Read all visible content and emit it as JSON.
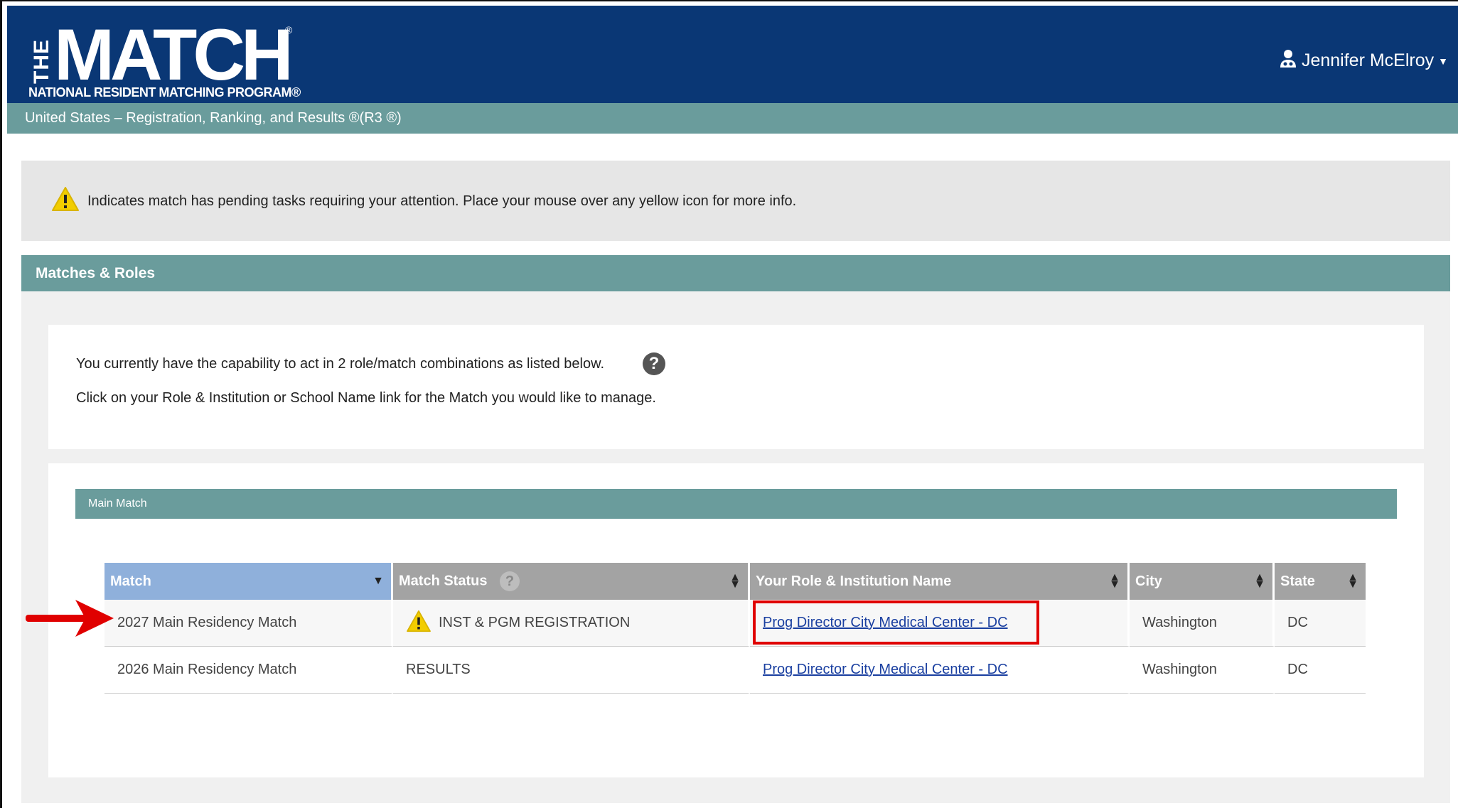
{
  "header": {
    "logo_the": "THE",
    "logo_match": "MATCH",
    "logo_tagline": "NATIONAL RESIDENT MATCHING PROGRAM®",
    "user_name": "Jennifer McElroy"
  },
  "subbar": {
    "text": "United States  –  Registration, Ranking, and Results ®(R3 ®)"
  },
  "notice": {
    "text": "Indicates match has pending tasks requiring your attention. Place your mouse over any yellow icon for more info."
  },
  "section": {
    "title": "Matches & Roles"
  },
  "info": {
    "line1": "You currently have the capability to act in 2 role/match combinations as listed below.",
    "line2": "Click on your Role & Institution or School Name link for the Match you would like to manage."
  },
  "main_match": {
    "title": "Main Match",
    "columns": [
      "Match",
      "Match Status",
      "Your Role & Institution Name",
      "City",
      "State"
    ],
    "rows": [
      {
        "match": "2027 Main Residency Match",
        "status": "INST & PGM REGISTRATION",
        "role": "Prog Director City Medical Center - DC",
        "city": "Washington",
        "state": "DC"
      },
      {
        "match": "2026 Main Residency Match",
        "status": "RESULTS",
        "role": "Prog Director City Medical Center - DC",
        "city": "Washington",
        "state": "DC"
      }
    ]
  },
  "colors": {
    "navy": "#0a3775",
    "teal": "#6a9c9c",
    "highlight": "#e00000",
    "link": "#1a3fa0"
  }
}
